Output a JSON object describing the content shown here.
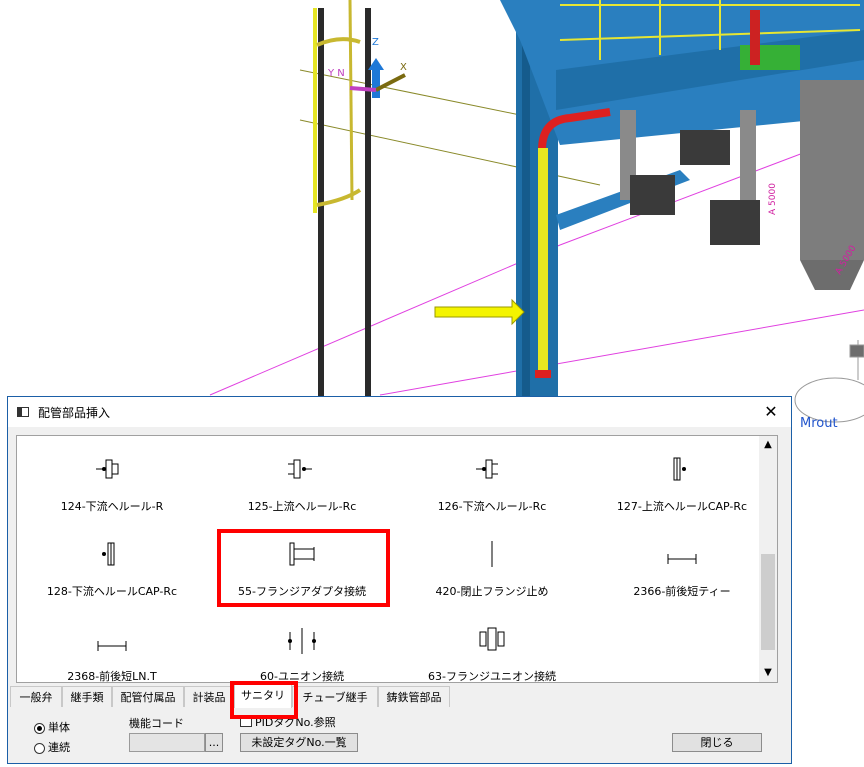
{
  "scene": {
    "axis_labels": [
      "Z",
      "X",
      "Y N"
    ],
    "dimension_labels": [
      "A 5000",
      "A 5000"
    ],
    "cut_text": "Mrout"
  },
  "dialog": {
    "title": "配管部品挿入",
    "close_label": "✕",
    "parts": [
      {
        "label": "124-下流ヘルール-R",
        "icon": "ferrule-downstream-icon"
      },
      {
        "label": "125-上流ヘルール-Rc",
        "icon": "ferrule-upstream-icon"
      },
      {
        "label": "126-下流ヘルール-Rc",
        "icon": "ferrule-downstream-rc-icon"
      },
      {
        "label": "127-上流ヘルールCAP-Rc",
        "icon": "ferrule-cap-upstream-icon"
      },
      {
        "label": "128-下流ヘルールCAP-Rc",
        "icon": "ferrule-cap-downstream-icon"
      },
      {
        "label": "55-フランジアダプタ接続",
        "icon": "flange-adapter-icon"
      },
      {
        "label": "420-閉止フランジ止め",
        "icon": "blind-flange-icon"
      },
      {
        "label": "2366-前後短ティー",
        "icon": "short-tee-icon"
      },
      {
        "label": "2368-前後短LN.T",
        "icon": "short-lnt-icon"
      },
      {
        "label": "60-ユニオン接続",
        "icon": "union-icon"
      },
      {
        "label": "63-フランジユニオン接続",
        "icon": "flange-union-icon"
      }
    ],
    "tabs": [
      "一般弁",
      "継手類",
      "配管付属品",
      "計装品",
      "サニタリ",
      "チューブ継手",
      "鋳鉄管部品"
    ],
    "active_tab": "サニタリ",
    "radio_single": "単体",
    "radio_continuous": "連続",
    "function_code_label": "機能コード",
    "function_code_value": "",
    "browse_label": "...",
    "pid_checkbox_label": "PIDタグNo.参照",
    "unset_tag_button": "未設定タグNo.一覧",
    "close_button": "閉じる"
  }
}
